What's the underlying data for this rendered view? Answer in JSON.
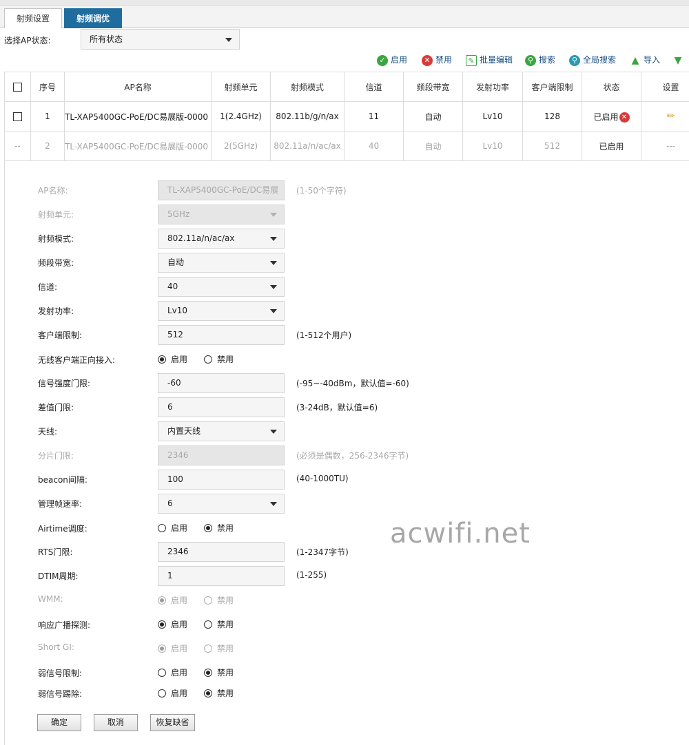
{
  "tabs": [
    {
      "label": "射频设置"
    },
    {
      "label": "射频调优"
    }
  ],
  "filter": {
    "label": "选择AP状态:",
    "value": "所有状态"
  },
  "toolbar": {
    "enable": "启用",
    "disable": "禁用",
    "batch_edit": "批量编辑",
    "search": "搜索",
    "global_search": "全局搜索",
    "import": "导入"
  },
  "table": {
    "headers": [
      "序号",
      "AP名称",
      "射频单元",
      "射频模式",
      "信道",
      "频段带宽",
      "发射功率",
      "客户端限制",
      "状态",
      "设置"
    ],
    "rows": [
      {
        "select": "",
        "index": "1",
        "ap_name": "TL-XAP5400GC-PoE/DC易展版-0000",
        "radio_unit": "1(2.4GHz)",
        "mode": "802.11b/g/n/ax",
        "channel": "11",
        "bandwidth": "自动",
        "power": "Lv10",
        "client_limit": "128",
        "status": "已启用",
        "settings": ""
      },
      {
        "select": "--",
        "index": "2",
        "ap_name": "TL-XAP5400GC-PoE/DC易展版-0000",
        "radio_unit": "2(5GHz)",
        "mode": "802.11a/n/ac/ax",
        "channel": "40",
        "bandwidth": "自动",
        "power": "Lv10",
        "client_limit": "512",
        "status": "已启用",
        "settings": "---"
      }
    ]
  },
  "form": {
    "ap_name": {
      "label": "AP名称:",
      "value": "TL-XAP5400GC-PoE/DC易展",
      "hint": "(1-50个字符)"
    },
    "radio_unit": {
      "label": "射频单元:",
      "value": "5GHz"
    },
    "mode": {
      "label": "射频模式:",
      "value": "802.11a/n/ac/ax"
    },
    "bandwidth": {
      "label": "频段带宽:",
      "value": "自动"
    },
    "channel": {
      "label": "信道:",
      "value": "40"
    },
    "power": {
      "label": "发射功率:",
      "value": "Lv10"
    },
    "client_limit": {
      "label": "客户端限制:",
      "value": "512",
      "hint": "(1-512个用户)"
    },
    "steering": {
      "label": "无线客户端正向接入:",
      "on": "启用",
      "off": "禁用"
    },
    "rssi_threshold": {
      "label": "信号强度门限:",
      "value": "-60",
      "hint": "(-95~-40dBm，默认值=-60)"
    },
    "diff_threshold": {
      "label": "差值门限:",
      "value": "6",
      "hint": "(3-24dB，默认值=6)"
    },
    "antenna": {
      "label": "天线:",
      "value": "内置天线"
    },
    "frag_threshold": {
      "label": "分片门限:",
      "value": "2346",
      "hint": "(必须是偶数，256-2346字节)"
    },
    "beacon": {
      "label": "beacon间隔:",
      "value": "100",
      "hint": "(40-1000TU)"
    },
    "mgmt_rate": {
      "label": "管理帧速率:",
      "value": "6"
    },
    "airtime": {
      "label": "Airtime调度:",
      "on": "启用",
      "off": "禁用"
    },
    "rts": {
      "label": "RTS门限:",
      "value": "2346",
      "hint": "(1-2347字节)"
    },
    "dtim": {
      "label": "DTIM周期:",
      "value": "1",
      "hint": "(1-255)"
    },
    "wmm": {
      "label": "WMM:",
      "on": "启用",
      "off": "禁用"
    },
    "probe": {
      "label": "响应广播探测:",
      "on": "启用",
      "off": "禁用"
    },
    "short_gi": {
      "label": "Short GI:",
      "on": "启用",
      "off": "禁用"
    },
    "weak_limit": {
      "label": "弱信号限制:",
      "on": "启用",
      "off": "禁用"
    },
    "weak_kick": {
      "label": "弱信号踢除:",
      "on": "启用",
      "off": "禁用"
    }
  },
  "buttons": {
    "ok": "确定",
    "cancel": "取消",
    "restore": "恢复缺省"
  },
  "watermark": "acwifi.net",
  "colors": {
    "tab_active": "#1f6d9e",
    "enable_icon": "#3aa640",
    "disable_icon": "#d93b3b",
    "link": "#1a4d80"
  }
}
